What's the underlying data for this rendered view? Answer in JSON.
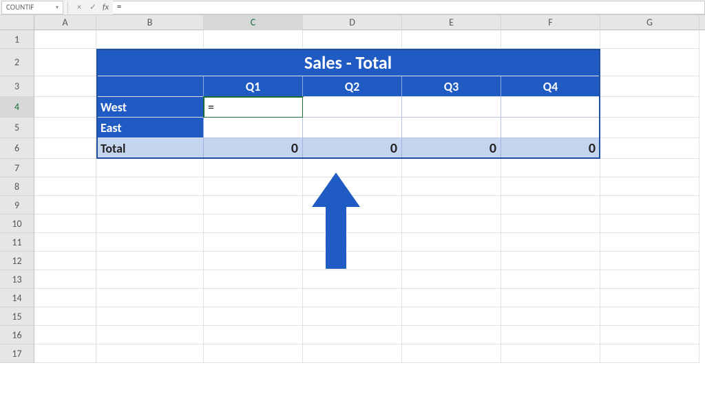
{
  "formula_bar": {
    "name_box": "COUNTIF",
    "cancel_icon": "×",
    "confirm_icon": "✓",
    "fx_label": "fx",
    "formula_value": "="
  },
  "columns": [
    "A",
    "B",
    "C",
    "D",
    "E",
    "F",
    "G"
  ],
  "active_column": "C",
  "row_labels": [
    "1",
    "2",
    "3",
    "4",
    "5",
    "6",
    "7",
    "8",
    "9",
    "10",
    "11",
    "12",
    "13",
    "14",
    "15",
    "16",
    "17"
  ],
  "active_row": "4",
  "table": {
    "title": "Sales - Total",
    "quarter_headers": [
      "Q1",
      "Q2",
      "Q3",
      "Q4"
    ],
    "rows": [
      {
        "label": "West",
        "values": [
          "=",
          "",
          "",
          ""
        ]
      },
      {
        "label": "East",
        "values": [
          "",
          "",
          "",
          ""
        ]
      }
    ],
    "total": {
      "label": "Total",
      "values": [
        "0",
        "0",
        "0",
        "0"
      ]
    }
  },
  "editing_cell": "C4",
  "annotation": {
    "arrow_points_to": "C4"
  },
  "chart_data": {
    "type": "table",
    "title": "Sales - Total",
    "columns": [
      "",
      "Q1",
      "Q2",
      "Q3",
      "Q4"
    ],
    "rows": [
      [
        "West",
        null,
        null,
        null,
        null
      ],
      [
        "East",
        null,
        null,
        null,
        null
      ],
      [
        "Total",
        0,
        0,
        0,
        0
      ]
    ],
    "note": "C4 is being edited; formula entered so far is '='"
  }
}
